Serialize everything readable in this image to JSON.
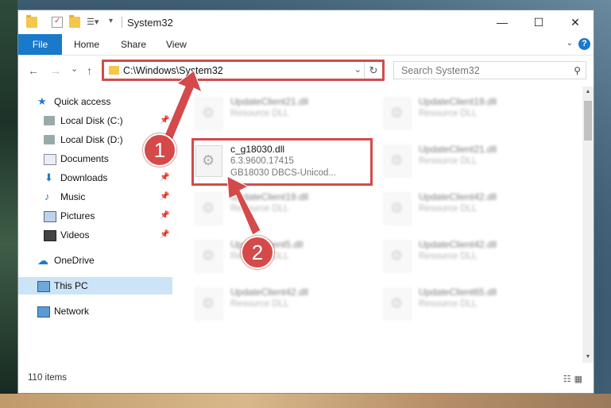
{
  "window": {
    "title": "System32",
    "controls": {
      "minimize": "—",
      "maximize": "☐",
      "close": "✕"
    }
  },
  "ribbon": {
    "tabs": [
      "File",
      "Home",
      "Share",
      "View"
    ],
    "help": "?"
  },
  "nav": {
    "back": "←",
    "forward": "→",
    "recent": "⌄",
    "up": "↑",
    "address": "C:\\Windows\\System32",
    "refresh": "↻",
    "search_placeholder": "Search System32"
  },
  "sidebar": {
    "items": [
      {
        "label": "Quick access",
        "icon": "star-icon"
      },
      {
        "label": "Local Disk (C:)",
        "icon": "drive-icon",
        "pinned": true
      },
      {
        "label": "Local Disk (D:)",
        "icon": "drive-icon",
        "pinned": true
      },
      {
        "label": "Documents",
        "icon": "documents-icon",
        "pinned": true
      },
      {
        "label": "Downloads",
        "icon": "downloads-icon",
        "pinned": true
      },
      {
        "label": "Music",
        "icon": "music-icon",
        "pinned": true
      },
      {
        "label": "Pictures",
        "icon": "pictures-icon",
        "pinned": true
      },
      {
        "label": "Videos",
        "icon": "videos-icon",
        "pinned": true
      },
      {
        "label": "OneDrive",
        "icon": "cloud-icon"
      },
      {
        "label": "This PC",
        "icon": "computer-icon",
        "selected": true
      },
      {
        "label": "Network",
        "icon": "network-icon"
      }
    ],
    "pin_glyph": "📌"
  },
  "files": [
    {
      "name": "UpdateClient21.dll",
      "type": "Resource DLL"
    },
    {
      "name": "UpdateClient19.dll",
      "type": "Resource DLL"
    },
    {
      "name": "c_g18030.dll",
      "version": "6.3.9600.17415",
      "desc": "GB18030 DBCS-Unicod..."
    },
    {
      "name": "UpdateClient21.dll",
      "type": "Resource DLL"
    },
    {
      "name": "UpdateClient19.dll",
      "type": "Resource DLL"
    },
    {
      "name": "UpdateClient42.dll",
      "type": "Resource DLL"
    },
    {
      "name": "UpdateClient5.dll",
      "type": "Resource DLL"
    },
    {
      "name": "UpdateClient42.dll",
      "type": "Resource DLL"
    },
    {
      "name": "UpdateClient42.dll",
      "type": "Resource DLL"
    },
    {
      "name": "UpdateClient65.dll",
      "type": "Resource DLL"
    }
  ],
  "status": {
    "count": "110 items"
  },
  "annotations": {
    "step1": "1",
    "step2": "2",
    "color": "#d44a4a"
  }
}
